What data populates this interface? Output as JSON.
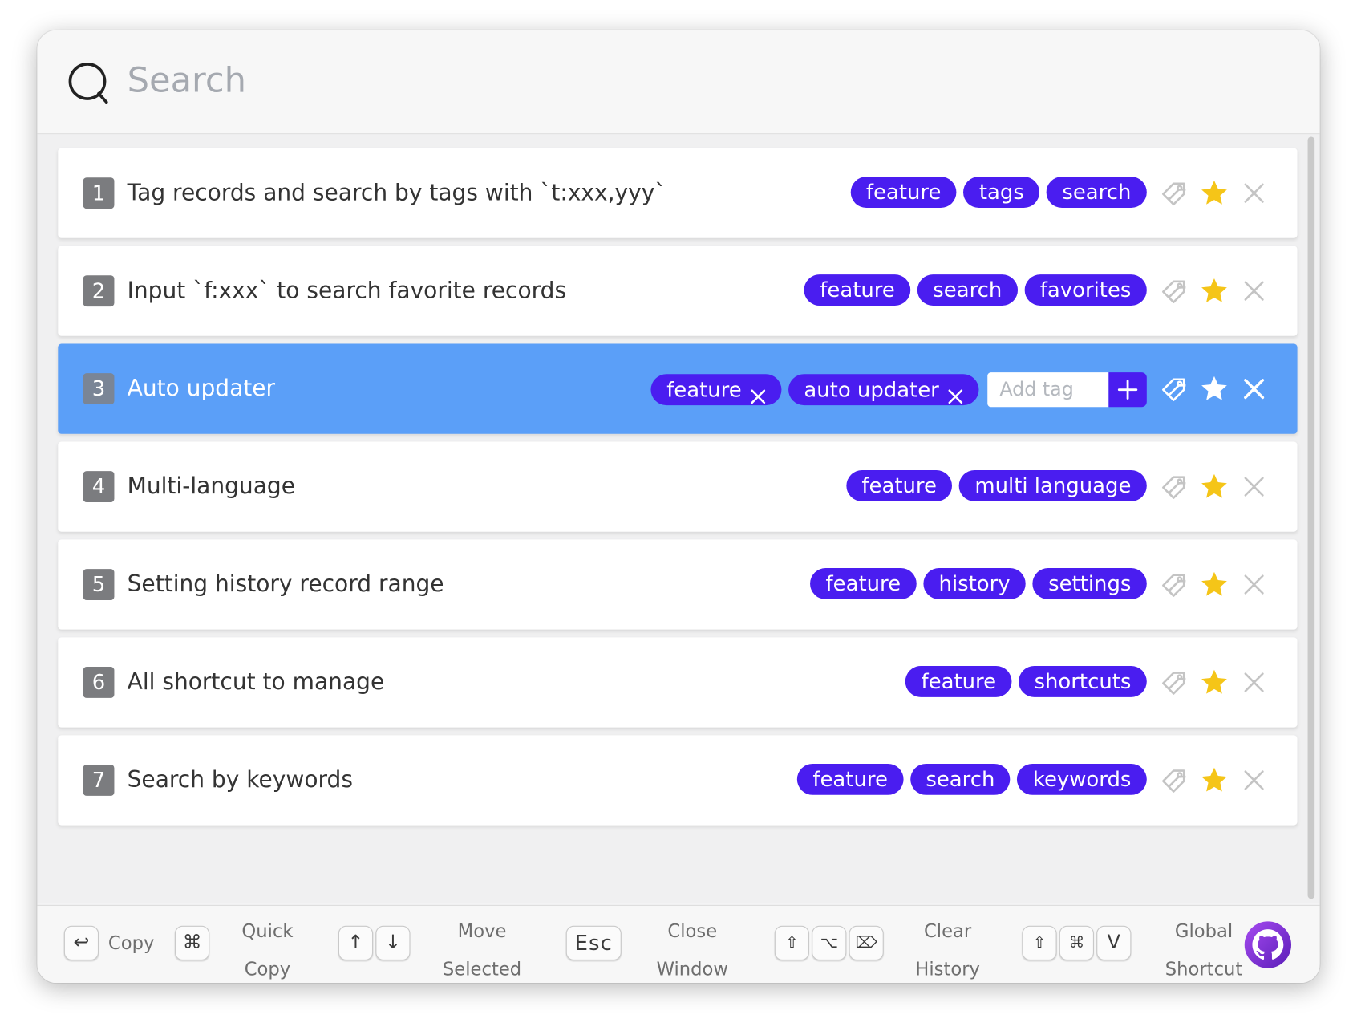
{
  "search": {
    "placeholder": "Search"
  },
  "records": [
    {
      "num": "1",
      "title": "Tag records and search by tags with `t:xxx,yyy`",
      "tags": [
        "feature",
        "tags",
        "search"
      ],
      "selected": false
    },
    {
      "num": "2",
      "title": "Input `f:xxx` to search favorite records",
      "tags": [
        "feature",
        "search",
        "favorites"
      ],
      "selected": false
    },
    {
      "num": "3",
      "title": "Auto updater",
      "tags": [
        "feature",
        "auto updater"
      ],
      "selected": true,
      "add_tag_placeholder": "Add tag"
    },
    {
      "num": "4",
      "title": "Multi-language",
      "tags": [
        "feature",
        "multi language"
      ],
      "selected": false
    },
    {
      "num": "5",
      "title": "Setting history record range",
      "tags": [
        "feature",
        "history",
        "settings"
      ],
      "selected": false
    },
    {
      "num": "6",
      "title": "All shortcut to manage",
      "tags": [
        "feature",
        "shortcuts"
      ],
      "selected": false
    },
    {
      "num": "7",
      "title": "Search by keywords",
      "tags": [
        "feature",
        "search",
        "keywords"
      ],
      "selected": false
    }
  ],
  "footer": {
    "copy": {
      "key": "↩",
      "label": "Copy"
    },
    "quick_copy": {
      "key": "⌘",
      "label_line1": "Quick",
      "label_line2": "Copy"
    },
    "move_selected": {
      "key_up": "↑",
      "key_down": "↓",
      "label_line1": "Move",
      "label_line2": "Selected"
    },
    "close_window": {
      "key": "Esc",
      "label_line1": "Close",
      "label_line2": "Window"
    },
    "clear_history": {
      "key_shift": "⇧",
      "key_option": "⌥",
      "key_delete": "⌦",
      "label_line1": "Clear",
      "label_line2": "History"
    },
    "global_shortcut": {
      "key_shift": "⇧",
      "key_cmd": "⌘",
      "key_v": "V",
      "label_line1": "Global",
      "label_line2": "Shortcut"
    }
  },
  "colors": {
    "tag_bg": "#4a1df0",
    "selected_row": "#5b9ff8",
    "star": "#f5c518",
    "muted_icon": "#c4c4c4"
  },
  "icons": {
    "search": "search-icon",
    "tag": "tag-icon",
    "star": "star-icon",
    "close": "close-icon",
    "plus": "plus-icon",
    "github": "github-icon"
  }
}
